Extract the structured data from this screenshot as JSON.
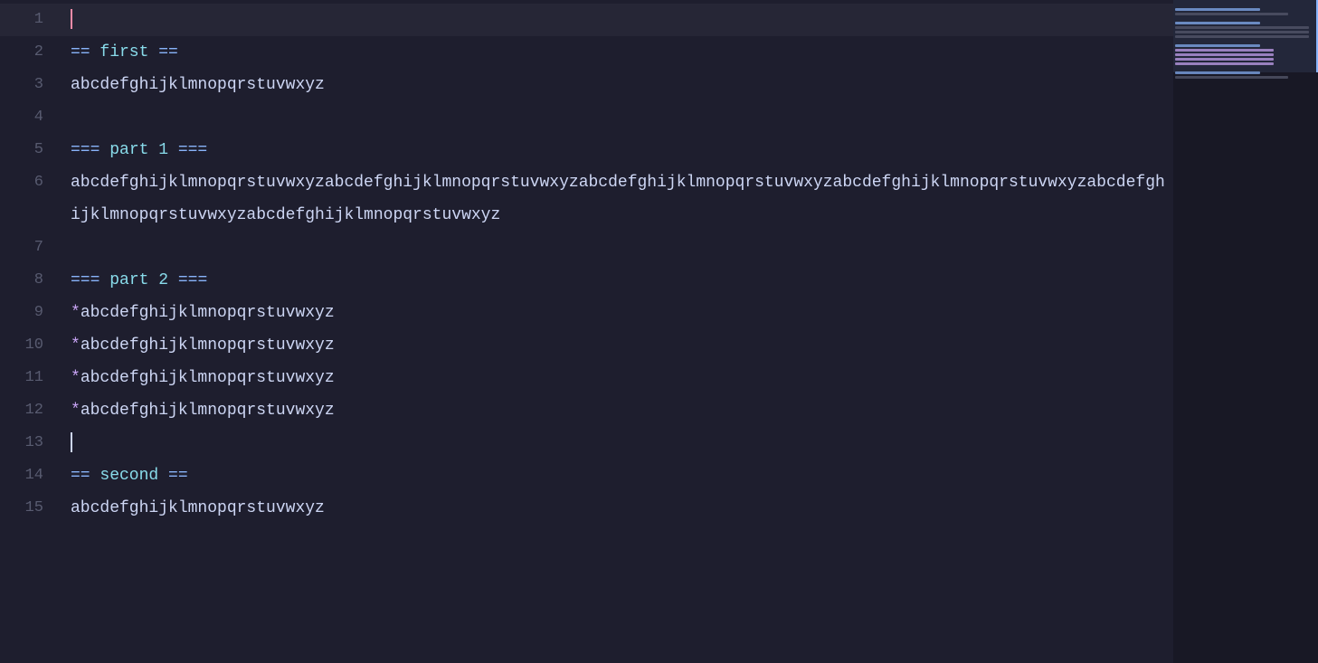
{
  "editor": {
    "background": "#1e1e2e",
    "lines": [
      {
        "num": 1,
        "type": "empty",
        "content": "",
        "cursor": true
      },
      {
        "num": 2,
        "type": "heading2",
        "markers_before": "== ",
        "text": "first",
        "markers_after": " ==",
        "content": "== first =="
      },
      {
        "num": 3,
        "type": "plain",
        "content": "abcdefghijklmnopqrstuvwxyz"
      },
      {
        "num": 4,
        "type": "empty",
        "content": ""
      },
      {
        "num": 5,
        "type": "heading3",
        "markers_before": "=== ",
        "text": "part 1",
        "markers_after": " ===",
        "content": "=== part 1 ==="
      },
      {
        "num": 6,
        "type": "plain_long",
        "content": "abcdefghijklmnopqrstuvwxyzabcdefghijklmnopqrstuvwxyzabcdefghijklmnopqrstuvwxyzabcdefghijklmnopqrstuvwxyzabcdefghijklmnopqrstuvwxyzabcdefghijklmnopqrstuvwxyz"
      },
      {
        "num": 7,
        "type": "empty",
        "content": ""
      },
      {
        "num": 8,
        "type": "heading3",
        "markers_before": "=== ",
        "text": "part 2",
        "markers_after": " ===",
        "content": "=== part 2 ==="
      },
      {
        "num": 9,
        "type": "bullet",
        "star": "*",
        "content": "abcdefghijklmnopqrstuvwxyz"
      },
      {
        "num": 10,
        "type": "bullet",
        "star": "*",
        "content": "abcdefghijklmnopqrstuvwxyz"
      },
      {
        "num": 11,
        "type": "bullet",
        "star": "*",
        "content": "abcdefghijklmnopqrstuvwxyz"
      },
      {
        "num": 12,
        "type": "bullet",
        "star": "*",
        "content": "abcdefghijklmnopqrstuvwxyz"
      },
      {
        "num": 13,
        "type": "empty",
        "content": ""
      },
      {
        "num": 14,
        "type": "heading2",
        "markers_before": "== ",
        "text": "second",
        "markers_after": " ==",
        "content": "== second =="
      },
      {
        "num": 15,
        "type": "plain",
        "content": "abcdefghijklmnopqrstuvwxyz"
      }
    ]
  },
  "minimap": {
    "lines": [
      "empty",
      "heading",
      "text",
      "empty",
      "heading",
      "long-text",
      "long-text",
      "long-text",
      "empty",
      "heading",
      "bullet",
      "bullet",
      "bullet",
      "bullet",
      "empty",
      "heading",
      "text"
    ]
  }
}
